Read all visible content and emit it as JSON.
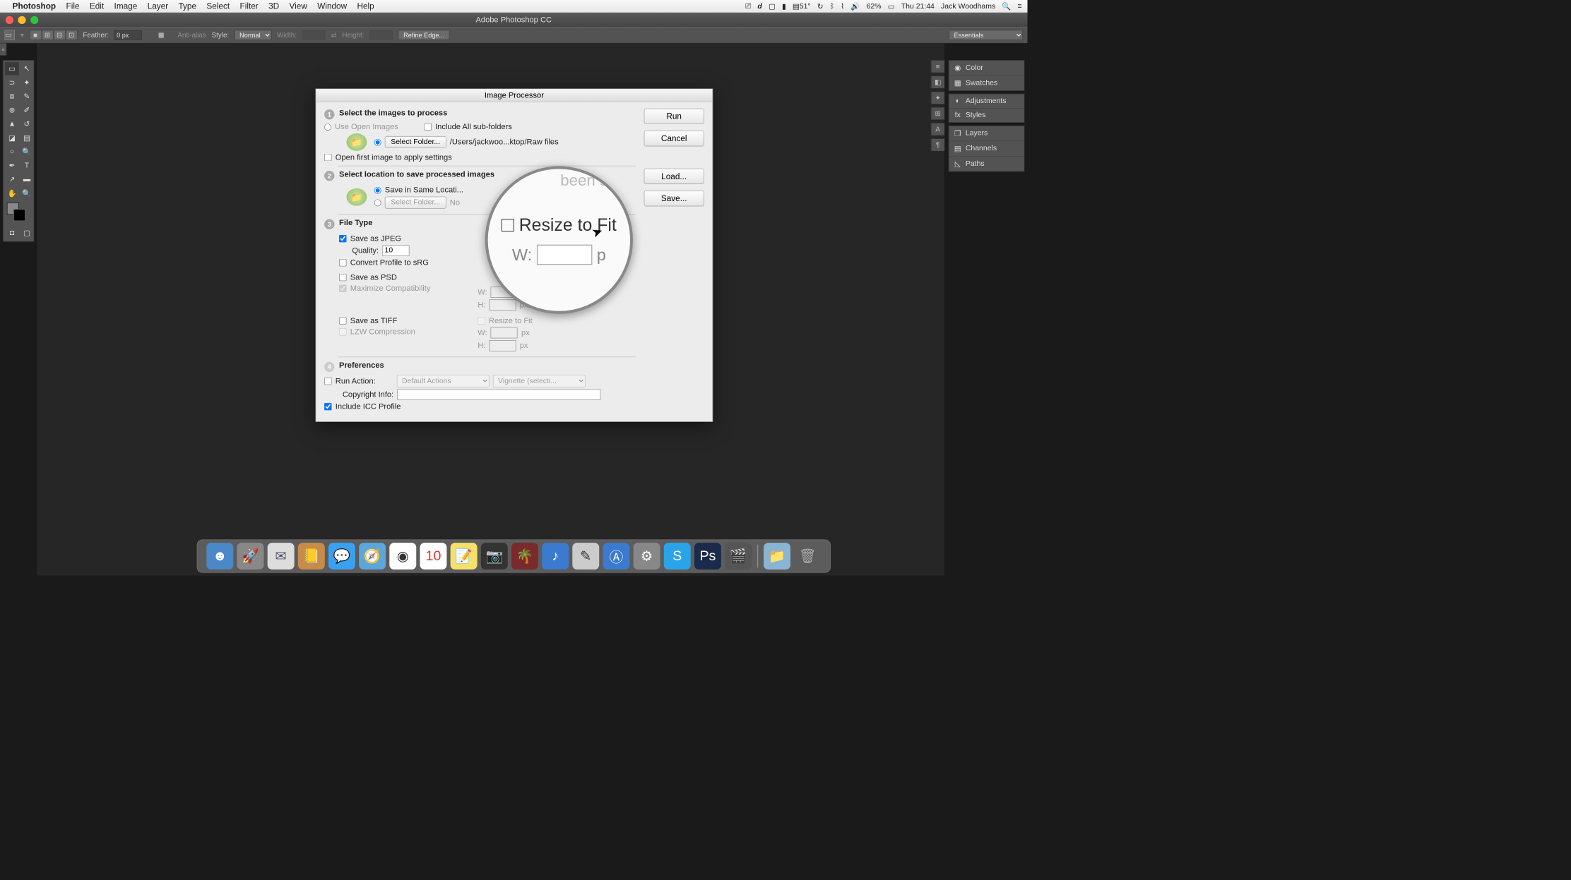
{
  "menubar": {
    "app": "Photoshop",
    "items": [
      "File",
      "Edit",
      "Image",
      "Layer",
      "Type",
      "Select",
      "Filter",
      "3D",
      "View",
      "Window",
      "Help"
    ],
    "status": {
      "temp": "51°",
      "battery": "62%",
      "clock": "Thu 21:44",
      "user": "Jack Woodhams"
    }
  },
  "window": {
    "title": "Adobe Photoshop CC"
  },
  "optbar": {
    "feather_label": "Feather:",
    "feather": "0 px",
    "antialias": "Anti-alias",
    "style_label": "Style:",
    "style": "Normal",
    "width_label": "Width:",
    "height_label": "Height:",
    "refine": "Refine Edge...",
    "workspace": "Essentials"
  },
  "panels": {
    "group1": [
      "Color",
      "Swatches"
    ],
    "group2": [
      "Adjustments",
      "Styles"
    ],
    "group3": [
      "Layers",
      "Channels",
      "Paths"
    ]
  },
  "dialog": {
    "title": "Image Processor",
    "buttons": {
      "run": "Run",
      "cancel": "Cancel",
      "load": "Load...",
      "save": "Save..."
    },
    "step1": {
      "head": "Select the images to process",
      "use_open": "Use Open Images",
      "include_sub": "Include All sub-folders",
      "select_folder": "Select Folder...",
      "path": "/Users/jackwoo...ktop/Raw files",
      "open_first": "Open first image to apply settings"
    },
    "step2": {
      "head": "Select location to save processed images",
      "same_loc": "Save in Same Locati...",
      "select_folder": "Select Folder...",
      "no": "No"
    },
    "step3": {
      "head": "File Type",
      "jpeg": "Save as JPEG",
      "quality_label": "Quality:",
      "quality": "10",
      "convert": "Convert Profile to sRG",
      "psd": "Save as PSD",
      "maxcompat": "Maximize Compatibility",
      "tiff": "Save as TIFF",
      "lzw": "LZW Compression",
      "resize": "Resize to Fit",
      "w": "W:",
      "h": "H:",
      "px": "px"
    },
    "step4": {
      "head": "Preferences",
      "run_action": "Run Action:",
      "action_set": "Default Actions",
      "action": "Vignette (selecti...",
      "copyright": "Copyright Info:",
      "icc": "Include ICC Profile"
    }
  },
  "loupe": {
    "resize": "Resize to Fit",
    "w": "W:",
    "faded": "been se",
    "px": "p"
  }
}
